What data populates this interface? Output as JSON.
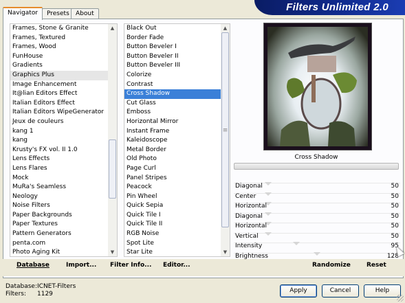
{
  "app": {
    "banner_title": "Filters Unlimited 2.0"
  },
  "tabs": [
    {
      "label": "Navigator",
      "active": true
    },
    {
      "label": "Presets",
      "active": false
    },
    {
      "label": "About",
      "active": false
    }
  ],
  "categories": {
    "items": [
      "Frames, Stone & Granite",
      "Frames, Textured",
      "Frames, Wood",
      "FunHouse",
      "Gradients",
      "Graphics Plus",
      "Image Enhancement",
      "It@lian Editors Effect",
      "Italian Editors Effect",
      "Italian Editors WipeGenerator",
      "Jeux de couleurs",
      "kang 1",
      "kang",
      "Krusty's FX vol. II 1.0",
      "Lens Effects",
      "Lens Flares",
      "Mock",
      "MuRa's Seamless",
      "Neology",
      "Noise Filters",
      "Paper Backgrounds",
      "Paper Textures",
      "Pattern Generators",
      "penta.com",
      "Photo Aging Kit"
    ],
    "highlighted": "Graphics Plus"
  },
  "filters": {
    "items": [
      "Black Out",
      "Border Fade",
      "Button Beveler I",
      "Button Beveler II",
      "Button Beveler III",
      "Colorize",
      "Contrast",
      "Cross Shadow",
      "Cut Glass",
      "Emboss",
      "Horizontal Mirror",
      "Instant Frame",
      "Kaleidoscope",
      "Metal Border",
      "Old Photo",
      "Page Curl",
      "Panel Stripes",
      "Peacock",
      "Pin Wheel",
      "Quick Sepia",
      "Quick Tile I",
      "Quick Tile II",
      "RGB Noise",
      "Spot Lite",
      "Star Lite"
    ],
    "selected": "Cross Shadow"
  },
  "preview": {
    "filter_name": "Cross Shadow"
  },
  "sliders": [
    {
      "label": "Diagonal",
      "value": "50",
      "level": 50
    },
    {
      "label": "Center",
      "value": "50",
      "level": 50
    },
    {
      "label": "Horizontal",
      "value": "50",
      "level": 50
    },
    {
      "label": "Diagonal",
      "value": "50",
      "level": 50
    },
    {
      "label": "Horizontal",
      "value": "50",
      "level": 50
    },
    {
      "label": "Vertical",
      "value": "50",
      "level": 50
    },
    {
      "label": "Intensity",
      "value": "95",
      "level": 95
    },
    {
      "label": "Brightness",
      "value": "128",
      "level": 128
    }
  ],
  "bottom_links": {
    "database": "Database",
    "import": "Import...",
    "filter_info": "Filter Info...",
    "editor": "Editor...",
    "randomize": "Randomize",
    "reset": "Reset"
  },
  "status": {
    "database_label": "Database:",
    "database_value": "ICNET-Filters",
    "filters_label": "Filters:",
    "filters_value": "1129"
  },
  "buttons": {
    "apply": "Apply",
    "cancel": "Cancel",
    "help": "Help"
  },
  "colors": {
    "selection": "#3b80d8",
    "banner": "#102a8c",
    "tab_accent": "#e68b2c"
  }
}
